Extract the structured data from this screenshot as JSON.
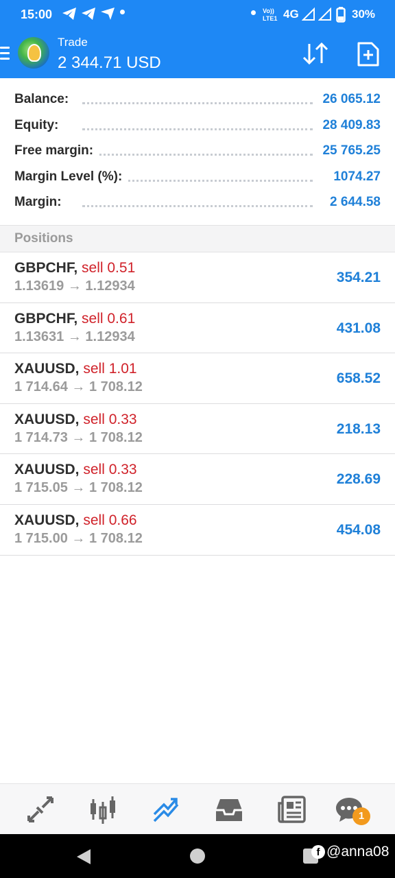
{
  "status_bar": {
    "time": "15:00",
    "network": "4G",
    "battery": "30%",
    "icons": [
      "telegram-icon",
      "telegram-icon",
      "telegram-icon",
      "notification-dot",
      "volte-icon",
      "signal-icon",
      "signal-icon",
      "battery-icon"
    ]
  },
  "header": {
    "title": "Trade",
    "balance": "2 344.71 USD",
    "icons": [
      "menu-icon",
      "metatrader-logo",
      "sort-icon",
      "new-order-icon"
    ]
  },
  "summary": [
    {
      "label": "Balance:",
      "value": "26 065.12"
    },
    {
      "label": "Equity:",
      "value": "28 409.83"
    },
    {
      "label": "Free margin:",
      "value": "25 765.25"
    },
    {
      "label": "Margin Level (%):",
      "value": "1074.27"
    },
    {
      "label": "Margin:",
      "value": "2 644.58"
    }
  ],
  "positions_header": "Positions",
  "positions": [
    {
      "symbol": "GBPCHF,",
      "side": "sell 0.51",
      "prices": "1.13619 → 1.12934",
      "profit": "354.21"
    },
    {
      "symbol": "GBPCHF,",
      "side": "sell 0.61",
      "prices": "1.13631 → 1.12934",
      "profit": "431.08"
    },
    {
      "symbol": "XAUUSD,",
      "side": "sell 1.01",
      "prices": "1 714.64 → 1 708.12",
      "profit": "658.52"
    },
    {
      "symbol": "XAUUSD,",
      "side": "sell 0.33",
      "prices": "1 714.73 → 1 708.12",
      "profit": "218.13"
    },
    {
      "symbol": "XAUUSD,",
      "side": "sell 0.33",
      "prices": "1 715.05 → 1 708.12",
      "profit": "228.69"
    },
    {
      "symbol": "XAUUSD,",
      "side": "sell 0.66",
      "prices": "1 715.00 → 1 708.12",
      "profit": "454.08"
    }
  ],
  "tabs": [
    {
      "icon": "quotes-icon",
      "active": false
    },
    {
      "icon": "chart-icon",
      "active": false
    },
    {
      "icon": "trade-icon",
      "active": true
    },
    {
      "icon": "history-icon",
      "active": false
    },
    {
      "icon": "news-icon",
      "active": false
    },
    {
      "icon": "messages-icon",
      "active": false
    }
  ],
  "messages_badge": "1",
  "watermark": "@anna08",
  "colors": {
    "header_bg": "#1e88f5",
    "value_blue": "#1f80d8",
    "sell_red": "#d0222a",
    "badge_orange": "#f29a1e"
  }
}
